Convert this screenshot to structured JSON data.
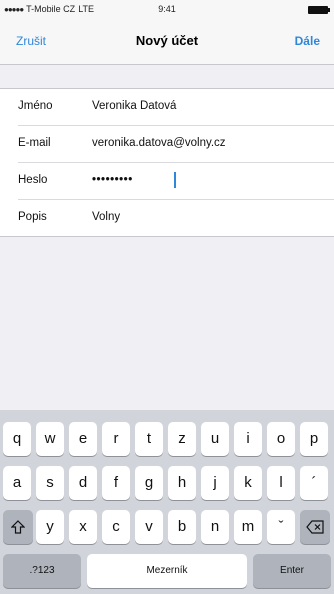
{
  "status": {
    "carrier": "T-Mobile CZ",
    "network": "LTE",
    "time": "9:41"
  },
  "nav": {
    "cancel": "Zrušit",
    "title": "Nový účet",
    "next": "Dále"
  },
  "form": {
    "name_label": "Jméno",
    "name_value": "Veronika Datová",
    "email_label": "E-mail",
    "email_value": "veronika.datova@volny.cz",
    "password_label": "Heslo",
    "password_value": "•••••••••",
    "description_label": "Popis",
    "description_value": "Volny"
  },
  "keyboard": {
    "row1": [
      "q",
      "w",
      "e",
      "r",
      "t",
      "z",
      "u",
      "i",
      "o",
      "p"
    ],
    "row2": [
      "a",
      "s",
      "d",
      "f",
      "g",
      "h",
      "j",
      "k",
      "l",
      "´"
    ],
    "row3": [
      "y",
      "x",
      "c",
      "v",
      "b",
      "n",
      "m",
      "ˇ"
    ],
    "numbers_label": ".?123",
    "space_label": "Mezerník",
    "enter_label": "Enter",
    "shift_icon": "shift-icon",
    "backspace_icon": "backspace-icon"
  },
  "colors": {
    "accent": "#2f87d9"
  }
}
